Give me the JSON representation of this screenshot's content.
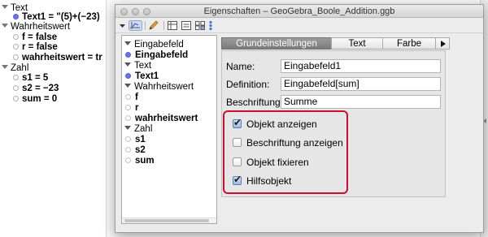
{
  "algebra_view": {
    "categories": [
      {
        "label": "Text",
        "items": [
          {
            "text": "Text1 = \"(5)+(−23)",
            "bold": true,
            "filled": true
          }
        ]
      },
      {
        "label": "Wahrheitswert",
        "items": [
          {
            "text": "f = false",
            "bold": true,
            "filled": false
          },
          {
            "text": "r = false",
            "bold": true,
            "filled": false
          },
          {
            "text": "wahrheitswert = tr",
            "bold": true,
            "filled": false
          }
        ]
      },
      {
        "label": "Zahl",
        "items": [
          {
            "text": "s1 = 5",
            "bold": true,
            "filled": false
          },
          {
            "text": "s2 = −23",
            "bold": true,
            "filled": false
          },
          {
            "text": "sum = 0",
            "bold": true,
            "filled": false
          }
        ]
      }
    ]
  },
  "dialog": {
    "title": "Eigenschaften – GeoGebra_Boole_Addition.ggb",
    "toolbar_icons": [
      "graphics-view-icon",
      "pencil-icon",
      "table-view-icon",
      "algebra-view-icon",
      "layout-grid-icon",
      "more-icon"
    ],
    "tree": {
      "categories": [
        {
          "label": "Eingabefeld",
          "items": [
            {
              "label": "Eingabefeld",
              "bold": true,
              "filled": true
            }
          ]
        },
        {
          "label": "Text",
          "items": [
            {
              "label": "Text1",
              "bold": true,
              "filled": true
            }
          ]
        },
        {
          "label": "Wahrheitswert",
          "items": [
            {
              "label": "f",
              "bold": true,
              "filled": false
            },
            {
              "label": "r",
              "bold": true,
              "filled": false
            },
            {
              "label": "wahrheitswert",
              "bold": true,
              "filled": false
            }
          ]
        },
        {
          "label": "Zahl",
          "items": [
            {
              "label": "s1",
              "bold": true,
              "filled": false
            },
            {
              "label": "s2",
              "bold": true,
              "filled": false
            },
            {
              "label": "sum",
              "bold": true,
              "filled": false
            }
          ]
        }
      ]
    },
    "tabs": [
      {
        "label": "Grundeinstellungen",
        "active": true
      },
      {
        "label": "Text",
        "active": false
      },
      {
        "label": "Farbe",
        "active": false
      }
    ],
    "fields": {
      "name_label": "Name:",
      "name_value": "Eingabefeld1",
      "definition_label": "Definition:",
      "definition_value": "Eingabefeld[sum]",
      "caption_label": "Beschriftung:",
      "caption_value": "Summe"
    },
    "checkboxes": [
      {
        "label": "Objekt anzeigen",
        "checked": true
      },
      {
        "label": "Beschriftung anzeigen",
        "checked": false
      },
      {
        "label": "Objekt fixieren",
        "checked": false
      },
      {
        "label": "Hilfsobjekt",
        "checked": true
      }
    ]
  },
  "colors": {
    "highlight_border": "#c8102e",
    "dot_selected": "#6f6fe6",
    "tab_active": "#8a8a8a"
  }
}
